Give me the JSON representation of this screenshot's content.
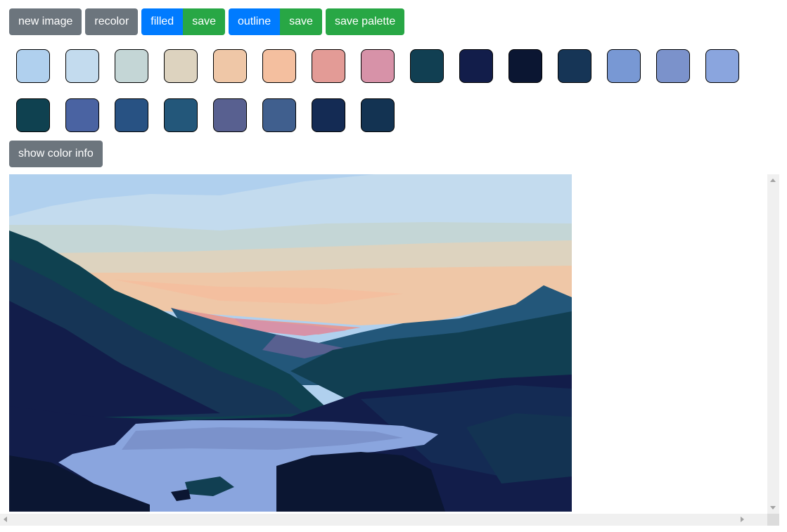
{
  "toolbar": {
    "new_image": "new image",
    "recolor": "recolor",
    "filled": "filled",
    "filled_save": "save",
    "outline": "outline",
    "outline_save": "save",
    "save_palette": "save palette"
  },
  "palette": [
    "#b0d0ee",
    "#c3dbee",
    "#c4d6d6",
    "#ddd3bf",
    "#efc7a7",
    "#f4bf9f",
    "#e39b96",
    "#d792a8",
    "#113f52",
    "#121d4a",
    "#0b1632",
    "#163556",
    "#7898d4",
    "#7b92cb",
    "#8aa5de",
    "#0f4150",
    "#4a63a2",
    "#285283",
    "#23577a",
    "#586090",
    "#405f8e",
    "#142b54",
    "#133352"
  ],
  "color_info_button": "show color info",
  "image": {
    "description_icon": "posterized-landscape-image"
  }
}
